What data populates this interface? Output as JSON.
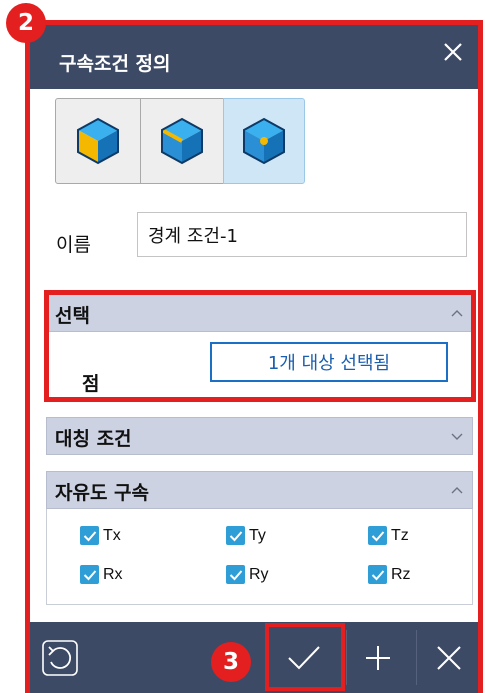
{
  "callouts": {
    "panel_step": "2",
    "confirm_step": "3"
  },
  "dialog": {
    "title": "구속조건 정의",
    "icons": {
      "close": "close-icon"
    }
  },
  "mode_buttons": [
    {
      "icon": "cube-face-icon",
      "selected": false
    },
    {
      "icon": "cube-edge-icon",
      "selected": false
    },
    {
      "icon": "cube-vertex-icon",
      "selected": true
    }
  ],
  "name_field": {
    "label": "이름",
    "value": "경계 조건-1"
  },
  "sections": {
    "selection": {
      "title": "선택",
      "expanded": true,
      "row_label": "점",
      "button_text": "1개 대상 선택됨"
    },
    "symmetry": {
      "title": "대칭 조건",
      "expanded": false
    },
    "dof": {
      "title": "자유도 구속",
      "expanded": true,
      "items": [
        {
          "label": "Tx",
          "checked": true
        },
        {
          "label": "Ty",
          "checked": true
        },
        {
          "label": "Tz",
          "checked": true
        },
        {
          "label": "Rx",
          "checked": true
        },
        {
          "label": "Ry",
          "checked": true
        },
        {
          "label": "Rz",
          "checked": true
        }
      ]
    }
  },
  "footer": {
    "buttons": [
      "reset-icon",
      "check-icon",
      "plus-icon",
      "close-icon"
    ]
  },
  "colors": {
    "titlebar": "#3d4a66",
    "section_header": "#cdd2e3",
    "accent_blue": "#1b6fc4",
    "highlight_red": "#e41f1f",
    "checkbox": "#2f9ed6",
    "cube_blue": "#1f8fd6",
    "cube_yellow": "#f5b800"
  }
}
